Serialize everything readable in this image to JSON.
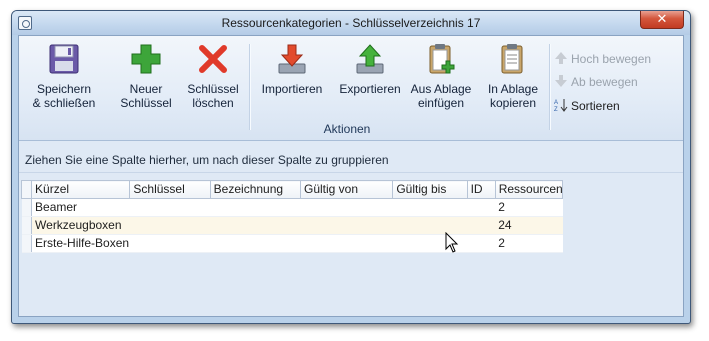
{
  "window": {
    "title": "Ressourcenkategorien - Schlüsselverzeichnis 17",
    "close_label": "✕"
  },
  "ribbon": {
    "buttons": [
      {
        "name": "save-close-button",
        "icon": "floppy-disk-icon",
        "line1": "Speichern",
        "line2": "& schließen"
      },
      {
        "name": "new-key-button",
        "icon": "plus-icon",
        "line1": "Neuer",
        "line2": "Schlüssel"
      },
      {
        "name": "delete-key-button",
        "icon": "red-x-icon",
        "line1": "Schlüssel",
        "line2": "löschen"
      },
      {
        "name": "import-button",
        "icon": "import-down-arrow-icon",
        "line1": "Importieren",
        "line2": ""
      },
      {
        "name": "export-button",
        "icon": "export-up-arrow-icon",
        "line1": "Exportieren",
        "line2": ""
      },
      {
        "name": "paste-from-clipboard-button",
        "icon": "clipboard-paste-icon",
        "line1": "Aus Ablage",
        "line2": "einfügen"
      },
      {
        "name": "copy-to-clipboard-button",
        "icon": "clipboard-copy-icon",
        "line1": "In Ablage",
        "line2": "kopieren"
      }
    ],
    "group_label": "Aktionen",
    "small_commands": [
      {
        "label": "Hoch bewegen",
        "icon": "arrow-up-icon",
        "enabled": false
      },
      {
        "label": "Ab bewegen",
        "icon": "arrow-down-icon",
        "enabled": false
      },
      {
        "label": "Sortieren",
        "icon": "sort-az-icon",
        "enabled": true
      }
    ]
  },
  "grid": {
    "group_hint": "Ziehen Sie eine Spalte hierher, um nach dieser Spalte zu gruppieren",
    "columns": [
      "Kürzel",
      "Schlüssel",
      "Bezeichnung",
      "Gültig von",
      "Gültig bis",
      "ID",
      "Ressourcen"
    ],
    "rows": [
      [
        "Beamer",
        "",
        "",
        "",
        "",
        "",
        "2"
      ],
      [
        "Werkzeugboxen",
        "",
        "",
        "",
        "",
        "",
        "24"
      ],
      [
        "Erste-Hilfe-Boxen",
        "",
        "",
        "",
        "",
        "",
        "2"
      ]
    ]
  },
  "colors": {
    "accent": "#3e5879",
    "plus_green": "#3da53a",
    "delete_red": "#e03a2a",
    "row_alt": "#fcf7e8"
  }
}
